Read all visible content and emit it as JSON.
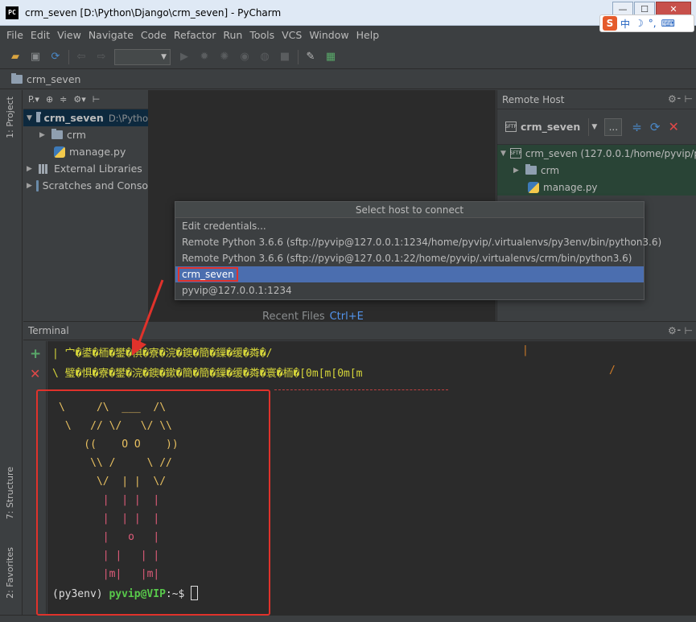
{
  "window": {
    "title": "crm_seven [D:\\Python\\Django\\crm_seven] - PyCharm",
    "app_icon_text": "PC",
    "minimize": "—",
    "maximize": "☐",
    "close": "✕"
  },
  "ime": {
    "logo": "S",
    "lang": "中",
    "moon": "☽",
    "punct": "°,",
    "keyboard": "⌨"
  },
  "menu": [
    "File",
    "Edit",
    "View",
    "Navigate",
    "Code",
    "Refactor",
    "Run",
    "Tools",
    "VCS",
    "Window",
    "Help"
  ],
  "breadcrumb": {
    "project": "crm_seven"
  },
  "left_strip": {
    "project_tab": "1: Project",
    "structure_tab": "7: Structure",
    "favorites_tab": "2: Favorites"
  },
  "project_panel": {
    "toolbar": [
      "P.▾",
      "⊕",
      "≑",
      "⚙▾",
      "⊢"
    ],
    "tree": [
      {
        "label": "crm_seven",
        "path": "D:\\Pytho",
        "type": "root"
      },
      {
        "label": "crm",
        "type": "folder"
      },
      {
        "label": "manage.py",
        "type": "py"
      },
      {
        "label": "External Libraries",
        "type": "lib"
      },
      {
        "label": "Scratches and Conso",
        "type": "scratch"
      }
    ]
  },
  "editor": {
    "recent_files": "Recent Files",
    "recent_shortcut": "Ctrl+E"
  },
  "remote_panel": {
    "title": "Remote Host",
    "controls": "⚙⁃ ⊢",
    "host": "crm_seven",
    "more": "...",
    "tree": [
      {
        "label": "crm_seven (127.0.0.1/home/pyvip/pr",
        "type": "root"
      },
      {
        "label": "crm",
        "type": "folder"
      },
      {
        "label": "manage.py",
        "type": "py"
      }
    ]
  },
  "popup": {
    "title": "Select host to connect",
    "items": [
      "Edit credentials...",
      "Remote Python 3.6.6 (sftp://pyvip@127.0.0.1:1234/home/pyvip/.virtualenvs/py3env/bin/python3.6)",
      "Remote Python 3.6.6 (sftp://pyvip@127.0.0.1:22/home/pyvip/.virtualenvs/crm/bin/python3.6)",
      "crm_seven",
      "pyvip@127.0.0.1:1234"
    ],
    "selected_index": 3
  },
  "terminal": {
    "title": "Terminal",
    "controls": "⚙⁃ ⊢",
    "line1": "| 宀�鍙�栭�鐢�惧�寮�浣�鐭�簡�鏁�缓�粦�/",
    "line1_end": "|",
    "line2": "\\ 璧�惧�寮�鐢�浣�鐭�鏉�簡�簡�鏁�缓�粦�寰�栭�",
    "line2_esc": "[0m[m[0m[m",
    "line2_end": "/",
    "ascii": [
      "\\     /\\  ___  /\\",
      " \\   // \\/   \\/ \\\\",
      "    ((    O O    ))",
      "     \\\\ /     \\ //",
      "      \\/  | |  \\/",
      "       |  | |  |",
      "       |  | |  |",
      "       |   o   |",
      "       | |   | |",
      "       |m|   |m|"
    ],
    "prompt_env": "(py3env) ",
    "prompt_user": "pyvip@VIP",
    "prompt_path": ":~$ "
  },
  "colors": {
    "annotation_red": "#e0322b",
    "selection_blue": "#4b6eaf",
    "terminal_bg": "#2b2b2b",
    "prompt_green": "#58c94b"
  }
}
